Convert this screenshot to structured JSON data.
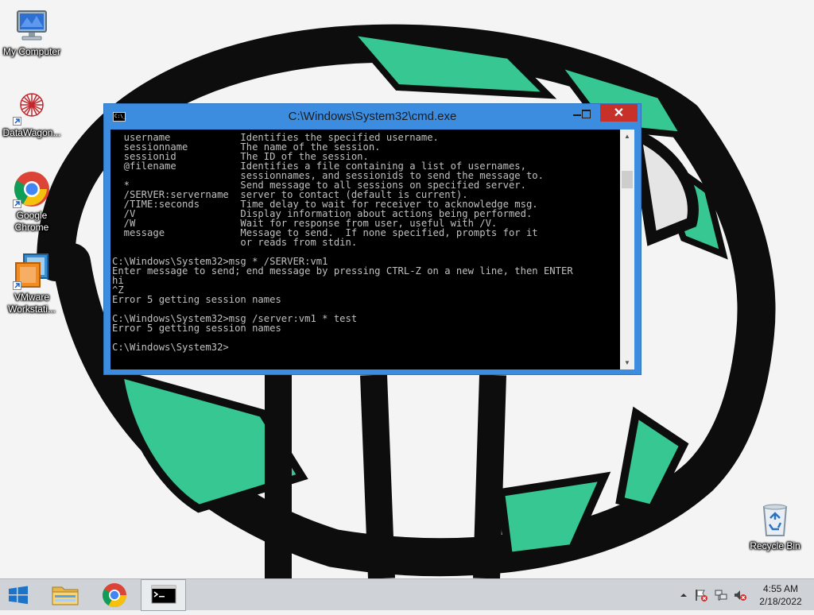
{
  "desktop": {
    "icons": [
      {
        "label": "My Computer",
        "icon": "my-computer-icon"
      },
      {
        "label": "DataWagon...",
        "icon": "datawagon-icon"
      },
      {
        "label": "Google Chrome",
        "icon": "chrome-icon"
      },
      {
        "label": "VMware Workstati...",
        "icon": "vmware-icon"
      },
      {
        "label": "Recycle Bin",
        "icon": "recycle-bin-icon"
      }
    ]
  },
  "window": {
    "title": "C:\\Windows\\System32\\cmd.exe",
    "icon_text": "C:\\_",
    "close_label": "✕",
    "console_lines": [
      "  username            Identifies the specified username.",
      "  sessionname         The name of the session.",
      "  sessionid           The ID of the session.",
      "  @filename           Identifies a file containing a list of usernames,",
      "                      sessionnames, and sessionids to send the message to.",
      "  *                   Send message to all sessions on specified server.",
      "  /SERVER:servername  server to contact (default is current).",
      "  /TIME:seconds       Time delay to wait for receiver to acknowledge msg.",
      "  /V                  Display information about actions being performed.",
      "  /W                  Wait for response from user, useful with /V.",
      "  message             Message to send.  If none specified, prompts for it",
      "                      or reads from stdin.",
      "",
      "C:\\Windows\\System32>msg * /SERVER:vm1",
      "Enter message to send; end message by pressing CTRL-Z on a new line, then ENTER",
      "hi",
      "^Z",
      "Error 5 getting session names",
      "",
      "C:\\Windows\\System32>msg /server:vm1 * test",
      "Error 5 getting session names",
      "",
      "C:\\Windows\\System32>"
    ]
  },
  "taskbar": {
    "items": [
      "start-button",
      "file-explorer",
      "google-chrome",
      "command-prompt"
    ],
    "clock_time": "4:55 AM",
    "clock_date": "2/18/2022"
  },
  "colors": {
    "window_frame": "#3c8de0",
    "close_button": "#c7312a",
    "taskbar": "#cfd3d7",
    "console_bg": "#000000",
    "console_fg": "#c0c0c0"
  }
}
